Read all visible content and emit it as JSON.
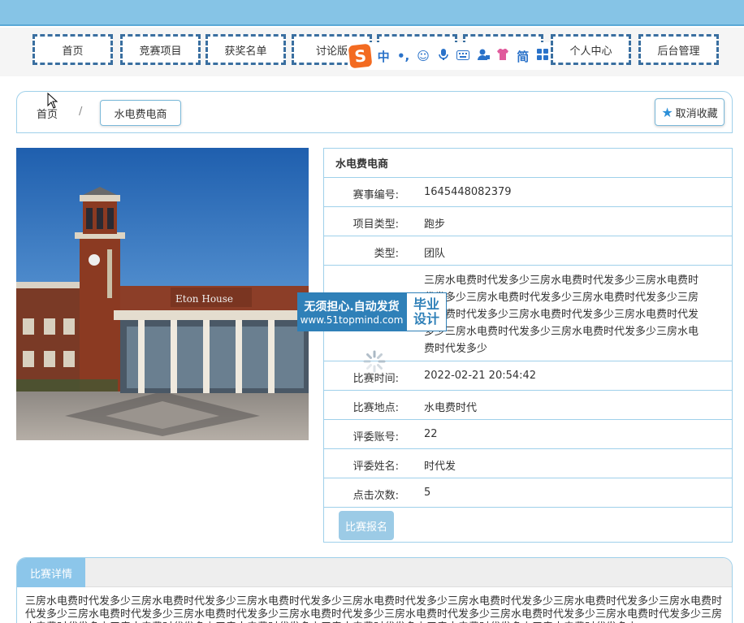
{
  "nav": {
    "items": [
      "首页",
      "竞赛项目",
      "获奖名单",
      "讨论版",
      "",
      "",
      "个人中心",
      "后台管理"
    ]
  },
  "ime": {
    "logo": "S",
    "glyphs": [
      "中",
      "•,",
      "☺",
      "🎤",
      "⌨",
      "👤",
      "👕",
      "简",
      "▦"
    ]
  },
  "breadcrumb": {
    "home": "首页",
    "separator": "/",
    "current": "水电费电商"
  },
  "favorite": {
    "label": "取消收藏",
    "icon": "star-icon"
  },
  "detail": {
    "title": "水电费电商",
    "fields": [
      {
        "label": "赛事编号:",
        "value": "1645448082379"
      },
      {
        "label": "项目类型:",
        "value": "跑步"
      },
      {
        "label": "类型:",
        "value": "团队"
      }
    ],
    "intro": "三房水电费时代发多少三房水电费时代发多少三房水电费时代发多少三房水电费时代发多少三房水电费时代发多少三房水电费时代发多少三房水电费时代发多少三房水电费时代发多少三房水电费时代发多少三房水电费时代发多少三房水电费时代发多少",
    "fields2": [
      {
        "label": "比赛时间:",
        "value": "2022-02-21 20:54:42"
      },
      {
        "label": "比赛地点:",
        "value": "水电费时代"
      },
      {
        "label": "评委账号:",
        "value": "22"
      },
      {
        "label": "评委姓名:",
        "value": "时代发"
      },
      {
        "label": "点击次数:",
        "value": "5"
      }
    ],
    "signup_label": "比赛报名"
  },
  "watermark": {
    "line1": "无须担心.自动发货",
    "line2": "www.51topmind.com",
    "right1": "毕业",
    "right2": "设计"
  },
  "panel": {
    "tab": "比赛详情",
    "body": "三房水电费时代发多少三房水电费时代发多少三房水电费时代发多少三房水电费时代发多少三房水电费时代发多少三房水电费时代发多少三房水电费时代发多少三房水电费时代发多少三房水电费时代发多少三房水电费时代发多少三房水电费时代发多少三房水电费时代发多少三房水电费时代发多少三房水电费时代发多少三房水电费时代发多少三房水电费时代发多少三房水电费时代发多少三房水电费时代发多少三房水电费时代发多少"
  },
  "photo": {
    "sign_text": "Eton House"
  },
  "colors": {
    "accent": "#86c4e6",
    "border": "#9fd0ea",
    "nav_dash": "#3a6fa0"
  }
}
